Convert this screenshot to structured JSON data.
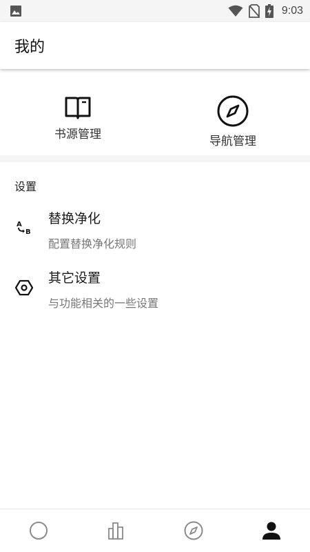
{
  "status_bar": {
    "time": "9:03",
    "icons": [
      "image-icon",
      "wifi-icon",
      "no-sim-icon",
      "battery-charging-icon"
    ]
  },
  "app_bar": {
    "title": "我的"
  },
  "top_actions": [
    {
      "label": "书源管理",
      "icon": "book-open-icon"
    },
    {
      "label": "导航管理",
      "icon": "compass-icon"
    }
  ],
  "settings": {
    "header": "设置",
    "items": [
      {
        "title": "替换净化",
        "summary": "配置替换净化规则",
        "icon": "replace-ab-icon"
      },
      {
        "title": "其它设置",
        "summary": "与功能相关的一些设置",
        "icon": "settings-hexagon-icon"
      }
    ]
  },
  "bottom_nav": {
    "items": [
      {
        "icon": "circle-icon",
        "selected": false
      },
      {
        "icon": "bar-chart-icon",
        "selected": false
      },
      {
        "icon": "compass-icon",
        "selected": false
      },
      {
        "icon": "person-icon",
        "selected": true
      }
    ]
  },
  "colors": {
    "status_bar_bg": "#f5f5f5",
    "app_bar_bg": "#ffffff",
    "text_primary": "#212121",
    "text_secondary": "#777777",
    "divider": "#f4f4f4",
    "nav_inactive": "#8a8a8a",
    "nav_active": "#111111"
  }
}
